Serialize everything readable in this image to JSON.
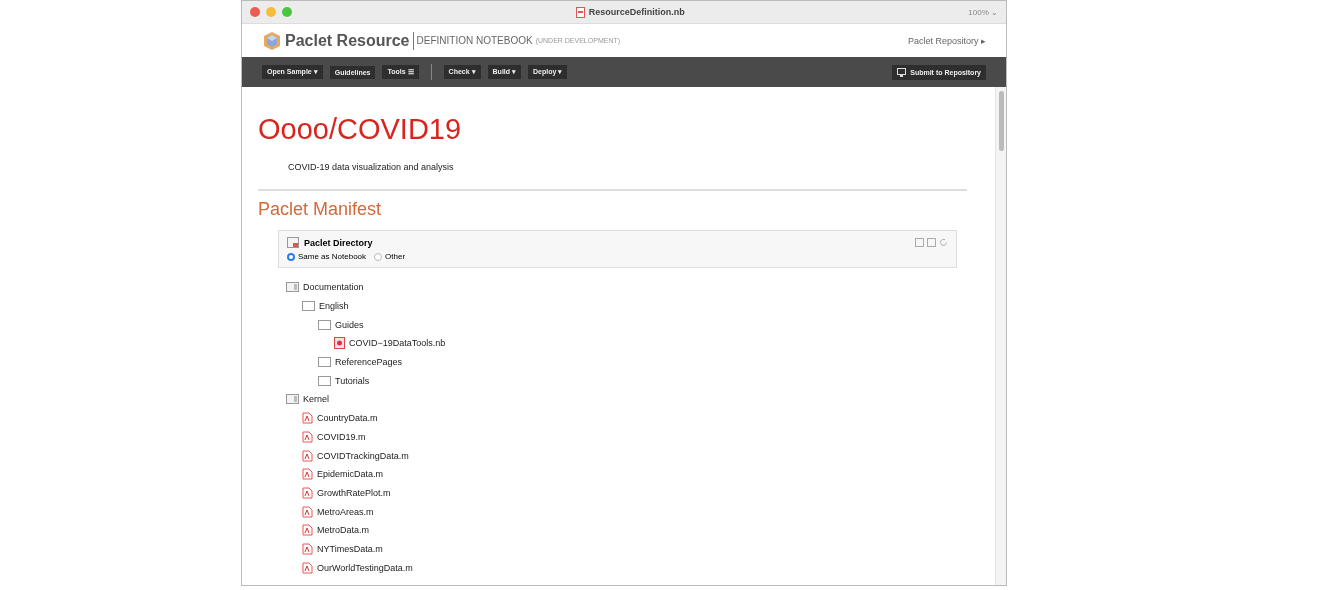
{
  "window": {
    "title": "ResourceDefinition.nb",
    "zoom": "100% ⌄"
  },
  "header": {
    "brand": "Paclet Resource",
    "subtitle": "DEFINITION NOTEBOOK",
    "note": "(UNDER DEVELOPMENT)",
    "menu": "Paclet Repository ▸"
  },
  "toolbar": [
    {
      "label": "Open Sample ▾",
      "kind": "button"
    },
    {
      "label": "Guidelines",
      "kind": "button"
    },
    {
      "label": "Tools ☰",
      "kind": "button"
    },
    {
      "kind": "separator"
    },
    {
      "label": "Check ▾",
      "kind": "button"
    },
    {
      "label": "Build ▾",
      "kind": "button"
    },
    {
      "label": "Deploy ▾",
      "kind": "button"
    }
  ],
  "submit": "Submit to Repository",
  "title": "Oooo/COVID19",
  "description": "COVID-19 data visualization and analysis",
  "section": "Paclet Manifest",
  "directory": {
    "title": "Paclet Directory",
    "options": [
      {
        "label": "Same as Notebook",
        "selected": true
      },
      {
        "label": "Other",
        "selected": false
      }
    ]
  },
  "tree": [
    {
      "name": "Documentation",
      "kind": "root",
      "children": [
        {
          "name": "English",
          "kind": "folder",
          "children": [
            {
              "name": "Guides",
              "kind": "folder",
              "children": [
                {
                  "name": "COVID−19DataTools.nb",
                  "kind": "notebook"
                }
              ]
            },
            {
              "name": "ReferencePages",
              "kind": "folder"
            },
            {
              "name": "Tutorials",
              "kind": "folder"
            }
          ]
        }
      ]
    },
    {
      "name": "Kernel",
      "kind": "root",
      "children": [
        {
          "name": "CountryData.m",
          "kind": "package"
        },
        {
          "name": "COVID19.m",
          "kind": "package"
        },
        {
          "name": "COVIDTrackingData.m",
          "kind": "package"
        },
        {
          "name": "EpidemicData.m",
          "kind": "package"
        },
        {
          "name": "GrowthRatePlot.m",
          "kind": "package"
        },
        {
          "name": "MetroAreas.m",
          "kind": "package"
        },
        {
          "name": "MetroData.m",
          "kind": "package"
        },
        {
          "name": "NYTimesData.m",
          "kind": "package"
        },
        {
          "name": "OurWorldTestingData.m",
          "kind": "package"
        }
      ]
    }
  ]
}
